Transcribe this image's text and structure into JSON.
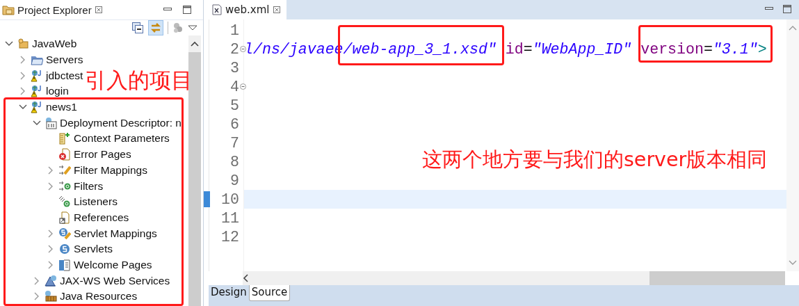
{
  "explorer": {
    "title": "Project Explorer",
    "tree": [
      {
        "label": "JavaWeb",
        "kind": "project",
        "expanded": true,
        "children": [
          {
            "label": "Servers",
            "kind": "folder",
            "expanded": false
          },
          {
            "label": "jdbctest",
            "kind": "web-project",
            "expanded": false
          },
          {
            "label": "login",
            "kind": "web-project",
            "expanded": false
          },
          {
            "label": "news1",
            "kind": "web-project",
            "expanded": true,
            "children": [
              {
                "label": "Deployment Descriptor: n",
                "kind": "descriptor",
                "expanded": true,
                "children": [
                  {
                    "label": "Context Parameters",
                    "kind": "context-params"
                  },
                  {
                    "label": "Error Pages",
                    "kind": "error-pages"
                  },
                  {
                    "label": "Filter Mappings",
                    "kind": "filter-mappings",
                    "expanded": false
                  },
                  {
                    "label": "Filters",
                    "kind": "filters",
                    "expanded": false
                  },
                  {
                    "label": "Listeners",
                    "kind": "listeners"
                  },
                  {
                    "label": "References",
                    "kind": "references"
                  },
                  {
                    "label": "Servlet Mappings",
                    "kind": "servlet-mappings",
                    "expanded": false
                  },
                  {
                    "label": "Servlets",
                    "kind": "servlets",
                    "expanded": false
                  },
                  {
                    "label": "Welcome Pages",
                    "kind": "welcome-pages",
                    "expanded": false
                  }
                ]
              },
              {
                "label": "JAX-WS Web Services",
                "kind": "web-services",
                "expanded": false
              },
              {
                "label": "Java Resources",
                "kind": "java-resources",
                "expanded": false
              }
            ]
          }
        ]
      }
    ]
  },
  "editor": {
    "tab": {
      "label": "web.xml",
      "selected": true
    },
    "lines": [
      {
        "number": "1"
      },
      {
        "number": "2",
        "fold": true,
        "tokens": [
          {
            "kind": "string",
            "text": "l/ns/javaee/web-app_3_1.xsd\""
          },
          {
            "kind": "attr",
            "text": " id"
          },
          {
            "kind": "punct",
            "text": "="
          },
          {
            "kind": "string",
            "text": "\"WebApp_ID\""
          },
          {
            "kind": "attr",
            "text": " version"
          },
          {
            "kind": "punct",
            "text": "="
          },
          {
            "kind": "string",
            "text": "\"3.1\""
          },
          {
            "kind": "tag",
            "text": ">"
          }
        ]
      },
      {
        "number": "3"
      },
      {
        "number": "4",
        "fold": true
      },
      {
        "number": "5"
      },
      {
        "number": "6"
      },
      {
        "number": "7"
      },
      {
        "number": "8"
      },
      {
        "number": "9"
      },
      {
        "number": "10",
        "current": true
      },
      {
        "number": "11"
      },
      {
        "number": "12"
      }
    ],
    "bottom_tabs": [
      {
        "label": "Design",
        "selected": false
      },
      {
        "label": "Source",
        "selected": true
      }
    ]
  },
  "annotations": {
    "texts": [
      "引入的项目",
      "这两个地方要与我们的server版本相同"
    ],
    "boxes": [
      {
        "kind": "frame"
      },
      {
        "kind": "frame"
      },
      {
        "kind": "frame"
      }
    ]
  }
}
